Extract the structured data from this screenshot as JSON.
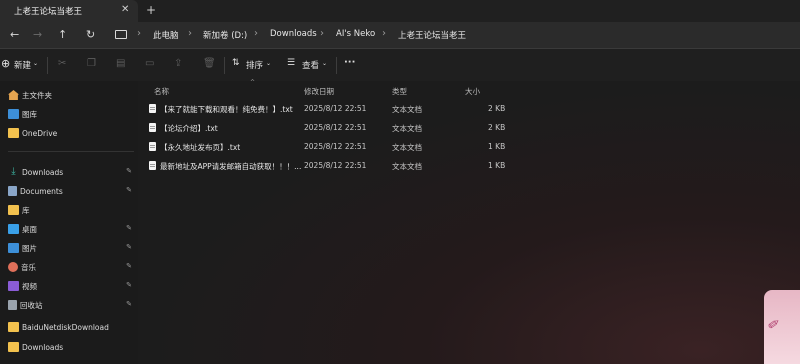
{
  "window": {
    "tab_title": "上老王论坛当老王",
    "tab_close_glyph": "✕",
    "new_tab_glyph": "+"
  },
  "nav": {
    "back": "←",
    "forward": "→",
    "up": "↑",
    "refresh": "↻",
    "breadcrumb": [
      "此电脑",
      "新加卷 (D:)",
      "Downloads",
      "AI's Neko",
      "上老王论坛当老王"
    ],
    "separator": "›"
  },
  "toolbar": {
    "new_label": "新建",
    "sort_label": "排序",
    "view_label": "查看",
    "more_label": "···"
  },
  "sidebar": {
    "items": [
      {
        "label": "主文件夹",
        "icon": "home-icon",
        "color": "#e6a550",
        "pinned": false
      },
      {
        "label": "图库",
        "icon": "gallery-icon",
        "color": "#3d8fd8",
        "pinned": false
      },
      {
        "label": "OneDrive",
        "icon": "folder-icon",
        "color": "#f2c14e",
        "pinned": false
      },
      {
        "label": "Downloads",
        "icon": "download-icon",
        "color": "#3bb3a0",
        "pinned": true
      },
      {
        "label": "Documents",
        "icon": "documents-icon",
        "color": "#8aa6c8",
        "pinned": true
      },
      {
        "label": "库",
        "icon": "folder-icon",
        "color": "#f2c14e",
        "pinned": false
      },
      {
        "label": "桌面",
        "icon": "desktop-icon",
        "color": "#3aa0e8",
        "pinned": true
      },
      {
        "label": "图片",
        "icon": "pictures-icon",
        "color": "#3d8fd8",
        "pinned": true
      },
      {
        "label": "音乐",
        "icon": "music-icon",
        "color": "#e0705a",
        "pinned": true
      },
      {
        "label": "视频",
        "icon": "videos-icon",
        "color": "#8b5cd6",
        "pinned": true
      },
      {
        "label": "回收站",
        "icon": "recycle-bin-icon",
        "color": "#9aa3ad",
        "pinned": true
      },
      {
        "label": "BaiduNetdiskDownload",
        "icon": "folder-icon",
        "color": "#f2c14e",
        "pinned": false
      },
      {
        "label": "Downloads",
        "icon": "folder-icon",
        "color": "#f2c14e",
        "pinned": false
      }
    ],
    "pin_glyph": "📌"
  },
  "columns": {
    "name": "名称",
    "modified": "修改日期",
    "type": "类型",
    "size": "大小",
    "sort_caret": "^"
  },
  "files": [
    {
      "name": "【来了就能下载和观看！纯免费！】.txt",
      "modified": "2025/8/12 22:51",
      "type": "文本文档",
      "size": "2 KB"
    },
    {
      "name": "【论坛介绍】.txt",
      "modified": "2025/8/12 22:51",
      "type": "文本文档",
      "size": "2 KB"
    },
    {
      "name": "【永久地址发布页】.txt",
      "modified": "2025/8/12 22:51",
      "type": "文本文档",
      "size": "1 KB"
    },
    {
      "name": "最新地址及APP请发邮箱自动获取！！！...",
      "modified": "2025/8/12 22:51",
      "type": "文本文档",
      "size": "1 KB"
    }
  ],
  "accent": "#60cdff"
}
